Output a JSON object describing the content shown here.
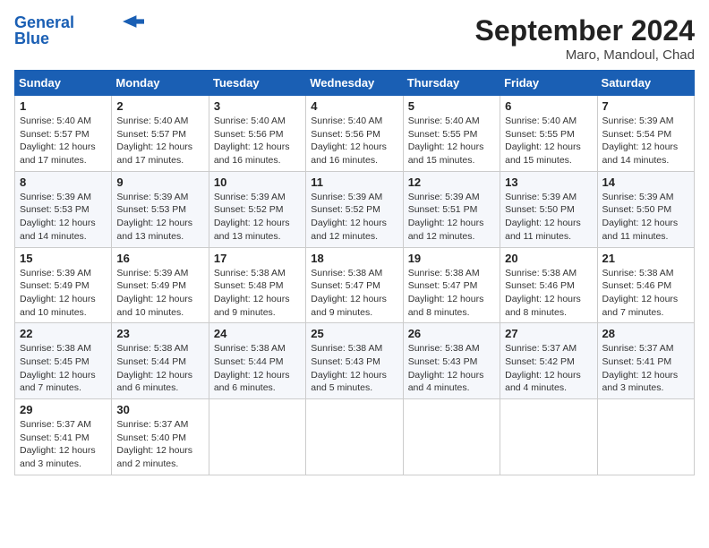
{
  "header": {
    "logo_line1": "General",
    "logo_line2": "Blue",
    "month": "September 2024",
    "location": "Maro, Mandoul, Chad"
  },
  "weekdays": [
    "Sunday",
    "Monday",
    "Tuesday",
    "Wednesday",
    "Thursday",
    "Friday",
    "Saturday"
  ],
  "weeks": [
    [
      {
        "day": "1",
        "info": "Sunrise: 5:40 AM\nSunset: 5:57 PM\nDaylight: 12 hours\nand 17 minutes."
      },
      {
        "day": "2",
        "info": "Sunrise: 5:40 AM\nSunset: 5:57 PM\nDaylight: 12 hours\nand 17 minutes."
      },
      {
        "day": "3",
        "info": "Sunrise: 5:40 AM\nSunset: 5:56 PM\nDaylight: 12 hours\nand 16 minutes."
      },
      {
        "day": "4",
        "info": "Sunrise: 5:40 AM\nSunset: 5:56 PM\nDaylight: 12 hours\nand 16 minutes."
      },
      {
        "day": "5",
        "info": "Sunrise: 5:40 AM\nSunset: 5:55 PM\nDaylight: 12 hours\nand 15 minutes."
      },
      {
        "day": "6",
        "info": "Sunrise: 5:40 AM\nSunset: 5:55 PM\nDaylight: 12 hours\nand 15 minutes."
      },
      {
        "day": "7",
        "info": "Sunrise: 5:39 AM\nSunset: 5:54 PM\nDaylight: 12 hours\nand 14 minutes."
      }
    ],
    [
      {
        "day": "8",
        "info": "Sunrise: 5:39 AM\nSunset: 5:53 PM\nDaylight: 12 hours\nand 14 minutes."
      },
      {
        "day": "9",
        "info": "Sunrise: 5:39 AM\nSunset: 5:53 PM\nDaylight: 12 hours\nand 13 minutes."
      },
      {
        "day": "10",
        "info": "Sunrise: 5:39 AM\nSunset: 5:52 PM\nDaylight: 12 hours\nand 13 minutes."
      },
      {
        "day": "11",
        "info": "Sunrise: 5:39 AM\nSunset: 5:52 PM\nDaylight: 12 hours\nand 12 minutes."
      },
      {
        "day": "12",
        "info": "Sunrise: 5:39 AM\nSunset: 5:51 PM\nDaylight: 12 hours\nand 12 minutes."
      },
      {
        "day": "13",
        "info": "Sunrise: 5:39 AM\nSunset: 5:50 PM\nDaylight: 12 hours\nand 11 minutes."
      },
      {
        "day": "14",
        "info": "Sunrise: 5:39 AM\nSunset: 5:50 PM\nDaylight: 12 hours\nand 11 minutes."
      }
    ],
    [
      {
        "day": "15",
        "info": "Sunrise: 5:39 AM\nSunset: 5:49 PM\nDaylight: 12 hours\nand 10 minutes."
      },
      {
        "day": "16",
        "info": "Sunrise: 5:39 AM\nSunset: 5:49 PM\nDaylight: 12 hours\nand 10 minutes."
      },
      {
        "day": "17",
        "info": "Sunrise: 5:38 AM\nSunset: 5:48 PM\nDaylight: 12 hours\nand 9 minutes."
      },
      {
        "day": "18",
        "info": "Sunrise: 5:38 AM\nSunset: 5:47 PM\nDaylight: 12 hours\nand 9 minutes."
      },
      {
        "day": "19",
        "info": "Sunrise: 5:38 AM\nSunset: 5:47 PM\nDaylight: 12 hours\nand 8 minutes."
      },
      {
        "day": "20",
        "info": "Sunrise: 5:38 AM\nSunset: 5:46 PM\nDaylight: 12 hours\nand 8 minutes."
      },
      {
        "day": "21",
        "info": "Sunrise: 5:38 AM\nSunset: 5:46 PM\nDaylight: 12 hours\nand 7 minutes."
      }
    ],
    [
      {
        "day": "22",
        "info": "Sunrise: 5:38 AM\nSunset: 5:45 PM\nDaylight: 12 hours\nand 7 minutes."
      },
      {
        "day": "23",
        "info": "Sunrise: 5:38 AM\nSunset: 5:44 PM\nDaylight: 12 hours\nand 6 minutes."
      },
      {
        "day": "24",
        "info": "Sunrise: 5:38 AM\nSunset: 5:44 PM\nDaylight: 12 hours\nand 6 minutes."
      },
      {
        "day": "25",
        "info": "Sunrise: 5:38 AM\nSunset: 5:43 PM\nDaylight: 12 hours\nand 5 minutes."
      },
      {
        "day": "26",
        "info": "Sunrise: 5:38 AM\nSunset: 5:43 PM\nDaylight: 12 hours\nand 4 minutes."
      },
      {
        "day": "27",
        "info": "Sunrise: 5:37 AM\nSunset: 5:42 PM\nDaylight: 12 hours\nand 4 minutes."
      },
      {
        "day": "28",
        "info": "Sunrise: 5:37 AM\nSunset: 5:41 PM\nDaylight: 12 hours\nand 3 minutes."
      }
    ],
    [
      {
        "day": "29",
        "info": "Sunrise: 5:37 AM\nSunset: 5:41 PM\nDaylight: 12 hours\nand 3 minutes."
      },
      {
        "day": "30",
        "info": "Sunrise: 5:37 AM\nSunset: 5:40 PM\nDaylight: 12 hours\nand 2 minutes."
      },
      {
        "day": "",
        "info": ""
      },
      {
        "day": "",
        "info": ""
      },
      {
        "day": "",
        "info": ""
      },
      {
        "day": "",
        "info": ""
      },
      {
        "day": "",
        "info": ""
      }
    ]
  ]
}
